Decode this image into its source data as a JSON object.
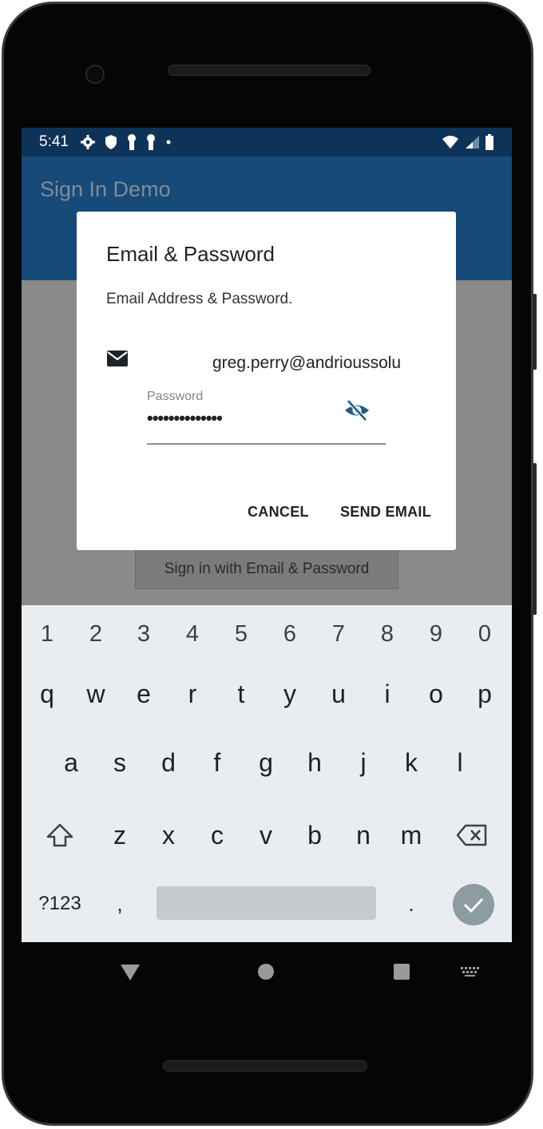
{
  "status_bar": {
    "time": "5:41"
  },
  "app_bar": {
    "title": "Sign In Demo"
  },
  "background_button": {
    "label": "Sign in with Email & Password"
  },
  "dialog": {
    "title": "Email & Password",
    "message": "Email Address & Password.",
    "email_value": "greg.perry@andrioussolu",
    "password_label": "Password",
    "password_value": "••••••••••••••",
    "cancel_label": "CANCEL",
    "send_label": "SEND EMAIL"
  },
  "keyboard": {
    "numbers": [
      "1",
      "2",
      "3",
      "4",
      "5",
      "6",
      "7",
      "8",
      "9",
      "0"
    ],
    "row1": [
      "q",
      "w",
      "e",
      "r",
      "t",
      "y",
      "u",
      "i",
      "o",
      "p"
    ],
    "row2": [
      "a",
      "s",
      "d",
      "f",
      "g",
      "h",
      "j",
      "k",
      "l"
    ],
    "row3": [
      "z",
      "x",
      "c",
      "v",
      "b",
      "n",
      "m"
    ],
    "symbols_label": "?123",
    "comma": ",",
    "period": "."
  },
  "colors": {
    "status_bar": "#0e3358",
    "app_bar": "#164a78",
    "accent": "#1d5d86",
    "keyboard_bg": "#e9edf0"
  }
}
